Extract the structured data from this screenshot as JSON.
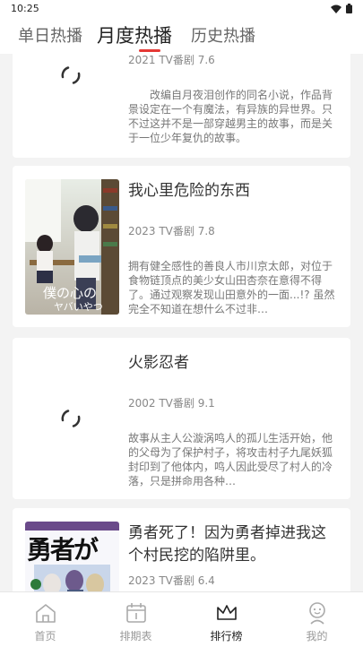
{
  "status_bar": {
    "time": "10:25"
  },
  "top_tabs": [
    {
      "label": "单日热播"
    },
    {
      "label": "月度热播"
    },
    {
      "label": "历史热播"
    }
  ],
  "items": [
    {
      "meta": "2021 TV番剧 7.6",
      "desc": "改编自月夜泪创作的同名小说，作品背景设定在一个有魔法，有异族的异世界。只不过这并不是一部穿越男主的故事，而是关于一位少年复仇的故事。"
    },
    {
      "title": "我心里危险的东西",
      "meta": "2023 TV番剧 7.8",
      "desc": "拥有健全感性的善良人市川京太郎，对位于食物链顶点的美少女山田杏奈在意得不得了。通过观察发现山田意外的一面...!? 虽然完全不知道在想什么不过非…"
    },
    {
      "title": "火影忍者",
      "meta": "2002 TV番剧 9.1",
      "desc": "故事从主人公漩涡鸣人的孤儿生活开始，他的父母为了保护村子，将攻击村子九尾妖狐封印到了他体内，鸣人因此受尽了村人的冷落，只是拼命用各种…"
    },
    {
      "title": "勇者死了！因为勇者掉进我这个村民挖的陷阱里。",
      "meta": "2023 TV番剧 6.4",
      "poster_text": "勇者が"
    }
  ],
  "bottom_nav": [
    {
      "label": "首页",
      "icon": "home-icon"
    },
    {
      "label": "排期表",
      "icon": "calendar-icon"
    },
    {
      "label": "排行榜",
      "icon": "crown-icon"
    },
    {
      "label": "我的",
      "icon": "profile-icon"
    }
  ],
  "colors": {
    "accent": "#e53935",
    "background": "#f3f3f3"
  }
}
